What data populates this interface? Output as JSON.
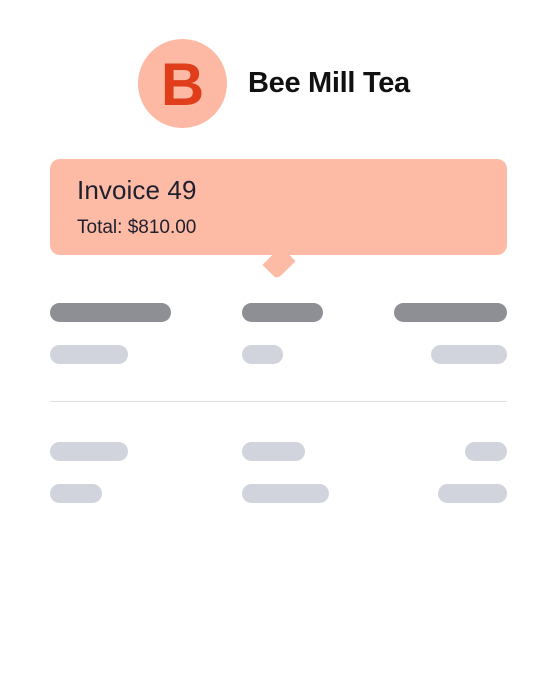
{
  "company": {
    "avatar_letter": "B",
    "name": "Bee Mill Tea"
  },
  "invoice": {
    "title": "Invoice 49",
    "total": "Total: $810.00"
  },
  "colors": {
    "avatar_bg": "#fdb9a3",
    "avatar_letter": "#e03d1a",
    "callout_bg": "#fdbaa5",
    "placeholder_header": "#8d8f95",
    "placeholder_row": "#d1d4dc"
  }
}
